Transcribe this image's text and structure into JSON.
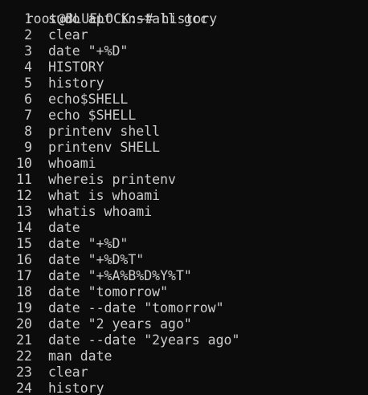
{
  "terminal": {
    "prompt": "root@BLUELOCK:~#",
    "command": "history",
    "entries": [
      {
        "num": "1",
        "cmd": "sudo apt install gcc"
      },
      {
        "num": "2",
        "cmd": "clear"
      },
      {
        "num": "3",
        "cmd": "date \"+%D\""
      },
      {
        "num": "4",
        "cmd": "HISTORY"
      },
      {
        "num": "5",
        "cmd": "history"
      },
      {
        "num": "6",
        "cmd": "echo$SHELL"
      },
      {
        "num": "7",
        "cmd": "echo $SHELL"
      },
      {
        "num": "8",
        "cmd": "printenv shell"
      },
      {
        "num": "9",
        "cmd": "printenv SHELL"
      },
      {
        "num": "10",
        "cmd": "whoami"
      },
      {
        "num": "11",
        "cmd": "whereis printenv"
      },
      {
        "num": "12",
        "cmd": "what is whoami"
      },
      {
        "num": "13",
        "cmd": "whatis whoami"
      },
      {
        "num": "14",
        "cmd": "date"
      },
      {
        "num": "15",
        "cmd": "date \"+%D\""
      },
      {
        "num": "16",
        "cmd": "date \"+%D%T\""
      },
      {
        "num": "17",
        "cmd": "date \"+%A%B%D%Y%T\""
      },
      {
        "num": "18",
        "cmd": "date \"tomorrow\""
      },
      {
        "num": "19",
        "cmd": "date --date \"tomorrow\""
      },
      {
        "num": "20",
        "cmd": "date \"2 years ago\""
      },
      {
        "num": "21",
        "cmd": "date --date \"2years ago\""
      },
      {
        "num": "22",
        "cmd": "man date"
      },
      {
        "num": "23",
        "cmd": "clear"
      },
      {
        "num": "24",
        "cmd": "history"
      }
    ]
  },
  "colors": {
    "background": "#0c0c0c",
    "foreground": "#cccccc"
  }
}
